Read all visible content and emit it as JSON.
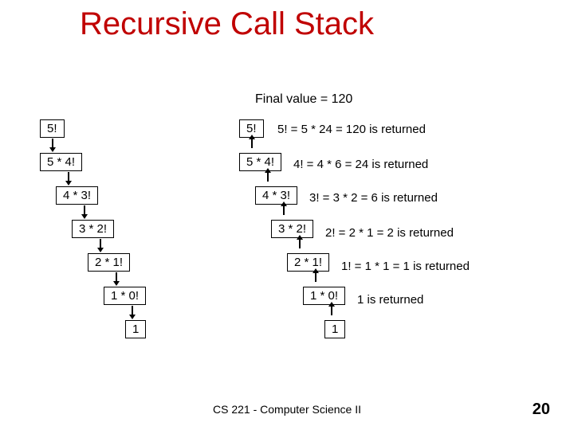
{
  "title": "Recursive Call Stack",
  "final_label": "Final value = 120",
  "left": {
    "b0": "5!",
    "b1": "5 * 4!",
    "b2": "4 * 3!",
    "b3": "3 * 2!",
    "b4": "2 * 1!",
    "b5": "1 * 0!",
    "b6": "1"
  },
  "right": {
    "b0": "5!",
    "b1": "5 * 4!",
    "b2": "4 * 3!",
    "b3": "3 * 2!",
    "b4": "2 * 1!",
    "b5": "1 * 0!",
    "b6": "1"
  },
  "ann": {
    "a0": "5! = 5 * 24 = 120 is  returned",
    "a1": "4! = 4 * 6 = 24 is returned",
    "a2": "3! = 3 * 2 = 6 is returned",
    "a3": "2! = 2 * 1 = 2 is returned",
    "a4": "1! = 1 * 1 = 1 is returned",
    "a5": "1 is returned"
  },
  "footer": "CS 221 - Computer Science II",
  "page": "20"
}
